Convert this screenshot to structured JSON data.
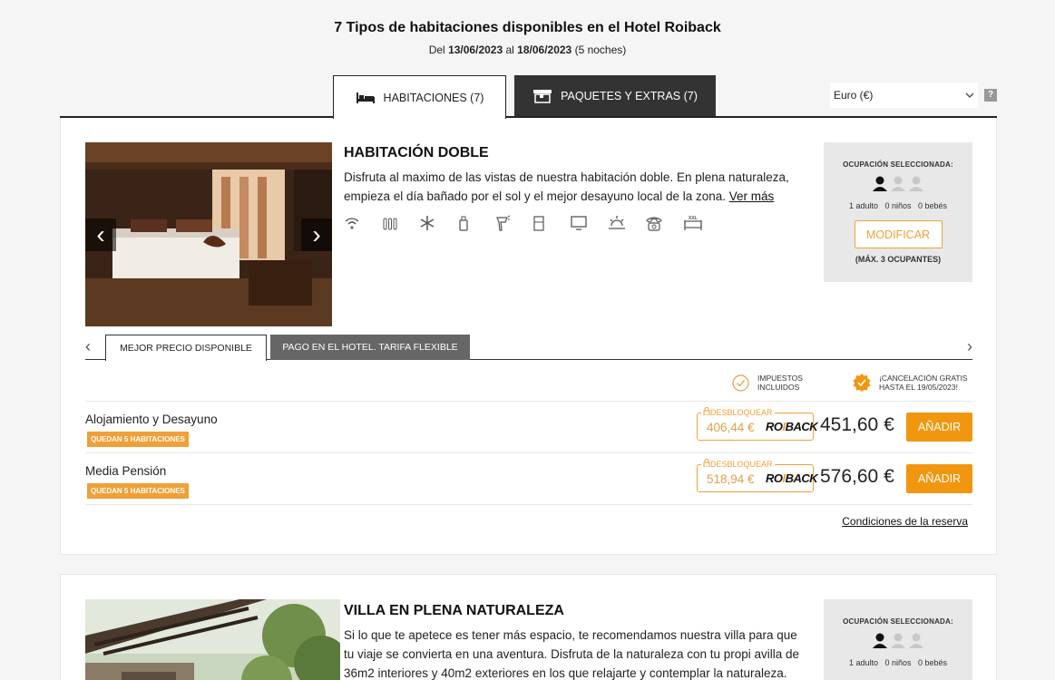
{
  "header": {
    "title": "7 Tipos de habitaciones disponibles en el Hotel Roiback",
    "dates_prefix": "Del",
    "date_from": "13/06/2023",
    "dates_middle": "al",
    "date_to": "18/06/2023",
    "nights": "(5 noches)"
  },
  "tabs": {
    "rooms": "HABITACIONES (7)",
    "packages": "PAQUETES Y EXTRAS (7)"
  },
  "currency": {
    "selected": "Euro (€)",
    "help": "?"
  },
  "rooms": [
    {
      "title": "HABITACIÓN DOBLE",
      "description": "Disfruta al maximo de las vistas de nuestra habitación doble. En plena naturaleza, empieza el día bañado por el sol y el mejor desayuno local de la zona.",
      "see_more": "Ver más",
      "amenities": [
        "wifi-icon",
        "heating-icon",
        "air-conditioning-icon",
        "toiletries-icon",
        "hairdryer-icon",
        "minibar-icon",
        "tv-icon",
        "terrace-icon",
        "phone-icon",
        "xxl-bed-icon"
      ],
      "occupancy": {
        "label": "OCUPACIÓN SELECCIONADA:",
        "counts": "1 adulto   0 niños   0 bebés",
        "modify": "MODIFICAR",
        "max": "(MÁX. 3 OCUPANTES)"
      },
      "rate_tabs": [
        "MEJOR PRECIO DISPONIBLE",
        "PAGO EN EL HOTEL. TARIFA FLEXIBLE"
      ],
      "badges": {
        "tax_line1": "IMPUESTOS",
        "tax_line2": "INCLUIDOS",
        "cancel_line1": "¡CANCELACIÓN GRATIS",
        "cancel_line2": "HASTA EL 19/05/2023!"
      },
      "rates": [
        {
          "name": "Alojamiento y Desayuno",
          "availability": "QUEDAN 5 HABITACIONES",
          "unlock_label": "DESBLOQUEAR",
          "unlock_price": "406,44 €",
          "price": "451,60 €",
          "add": "AÑADIR"
        },
        {
          "name": "Media Pensión",
          "availability": "QUEDAN 5 HABITACIONES",
          "unlock_label": "DESBLOQUEAR",
          "unlock_price": "518,94 €",
          "price": "576,60 €",
          "add": "AÑADIR"
        }
      ],
      "conditions": "Condiciones de la reserva"
    },
    {
      "title": "VILLA EN PLENA NATURALEZA",
      "description": "Si lo que te apetece es tener más espacio, te recomendamos nuestra villa para que tu viaje se convierta en una aventura. Disfruta de la naturaleza con tu propi avilla de 36m2 interiores y 40m2 exteriores en los que relajarte y contemplar la naturaleza.",
      "occupancy": {
        "label": "OCUPACIÓN SELECCIONADA:",
        "counts": "1 adulto   0 niños   0 bebés"
      }
    }
  ],
  "brand": {
    "part1": "RO",
    "part2": "I",
    "part3": "BACK"
  },
  "colors": {
    "accent": "#f0970f",
    "dark_tab": "#333333",
    "occupancy_bg": "#e8e8e8"
  }
}
